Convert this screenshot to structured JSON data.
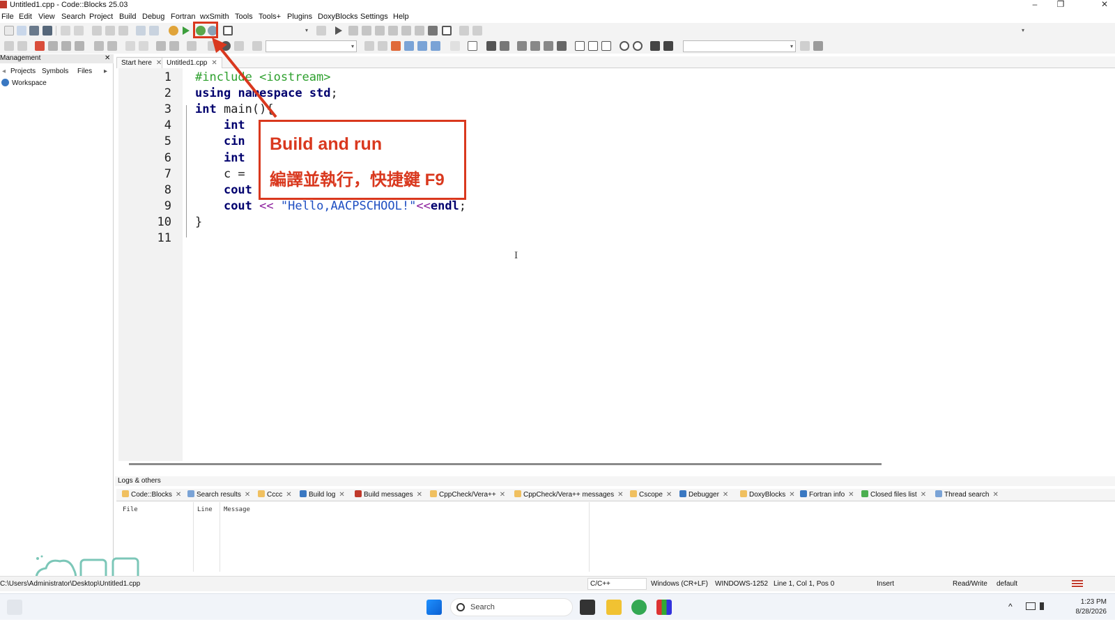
{
  "window": {
    "title": "Untitled1.cpp - Code::Blocks 25.03",
    "min": "–",
    "max": "❐",
    "close": "✕"
  },
  "menu": [
    "File",
    "Edit",
    "View",
    "Search",
    "Project",
    "Build",
    "Debug",
    "Fortran",
    "wxSmith",
    "Tools",
    "Tools+",
    "Plugins",
    "DoxyBlocks",
    "Settings",
    "Help"
  ],
  "management": {
    "title": "Management",
    "close": "✕",
    "tabs": [
      "Projects",
      "Symbols",
      "Files"
    ],
    "workspace": "Workspace"
  },
  "file_tabs": [
    {
      "label": "Start here",
      "close": "✕"
    },
    {
      "label": "Untitled1.cpp",
      "close": "✕"
    }
  ],
  "editor": {
    "line_numbers": [
      "1",
      "2",
      "3",
      "4",
      "5",
      "6",
      "7",
      "8",
      "9",
      "10",
      "11"
    ],
    "lines": [
      [
        {
          "t": "pp",
          "v": "#include <iostream>"
        }
      ],
      [
        {
          "t": "kw",
          "v": "using"
        },
        {
          "t": "",
          "v": " "
        },
        {
          "t": "kw",
          "v": "namespace"
        },
        {
          "t": "",
          "v": " "
        },
        {
          "t": "kw",
          "v": "std"
        },
        {
          "t": "",
          "v": ";"
        }
      ],
      [
        {
          "t": "kw",
          "v": "int"
        },
        {
          "t": "",
          "v": " main(){"
        }
      ],
      [
        {
          "t": "",
          "v": "    "
        },
        {
          "t": "kw",
          "v": "int"
        }
      ],
      [
        {
          "t": "",
          "v": "    "
        },
        {
          "t": "kw",
          "v": "cin"
        }
      ],
      [
        {
          "t": "",
          "v": "    "
        },
        {
          "t": "kw",
          "v": "int"
        }
      ],
      [
        {
          "t": "",
          "v": "    c ="
        }
      ],
      [
        {
          "t": "",
          "v": "    "
        },
        {
          "t": "kw",
          "v": "cout"
        }
      ],
      [
        {
          "t": "",
          "v": "    "
        },
        {
          "t": "kw",
          "v": "cout"
        },
        {
          "t": "",
          "v": " "
        },
        {
          "t": "op",
          "v": "<<"
        },
        {
          "t": "",
          "v": " "
        },
        {
          "t": "str",
          "v": "\"Hello,AACPSCHOOL!\""
        },
        {
          "t": "op",
          "v": "<<"
        },
        {
          "t": "kw",
          "v": "endl"
        },
        {
          "t": "",
          "v": ";"
        }
      ],
      [
        {
          "t": "",
          "v": "}"
        }
      ],
      [
        {
          "t": "",
          "v": ""
        }
      ]
    ]
  },
  "callout": {
    "title": "Build and run",
    "subtitle": "編譯並執行，快捷鍵 F9"
  },
  "cursor_glyph": "I",
  "logs": {
    "title": "Logs & others",
    "tabs": [
      "Code::Blocks",
      "Search results",
      "Cccc",
      "Build log",
      "Build messages",
      "CppCheck/Vera++",
      "CppCheck/Vera++ messages",
      "Cscope",
      "Debugger",
      "DoxyBlocks",
      "Fortran info",
      "Closed files list",
      "Thread search"
    ],
    "tab_close": "✕",
    "columns": [
      "File",
      "Line",
      "Message"
    ]
  },
  "status": {
    "path": "C:\\Users\\Administrator\\Desktop\\Untitled1.cpp",
    "lang": "C/C++",
    "eol": "Windows (CR+LF)",
    "encoding": "WINDOWS-1252",
    "position": "Line 1, Col 1, Pos 0",
    "mode": "Insert",
    "access": "Read/Write",
    "profile": "default"
  },
  "taskbar": {
    "search_placeholder": "Search",
    "time": "1:23 PM",
    "date": "8/28/2026",
    "tray_caret": "^"
  },
  "colors": {
    "accent_red": "#d9381e",
    "keyword": "#00006e",
    "preprocessor": "#2ea02e",
    "string": "#1e4fc2"
  },
  "icons": {
    "menu_arrow": "▾",
    "scroll_left": "◂",
    "scroll_right": "▸"
  }
}
